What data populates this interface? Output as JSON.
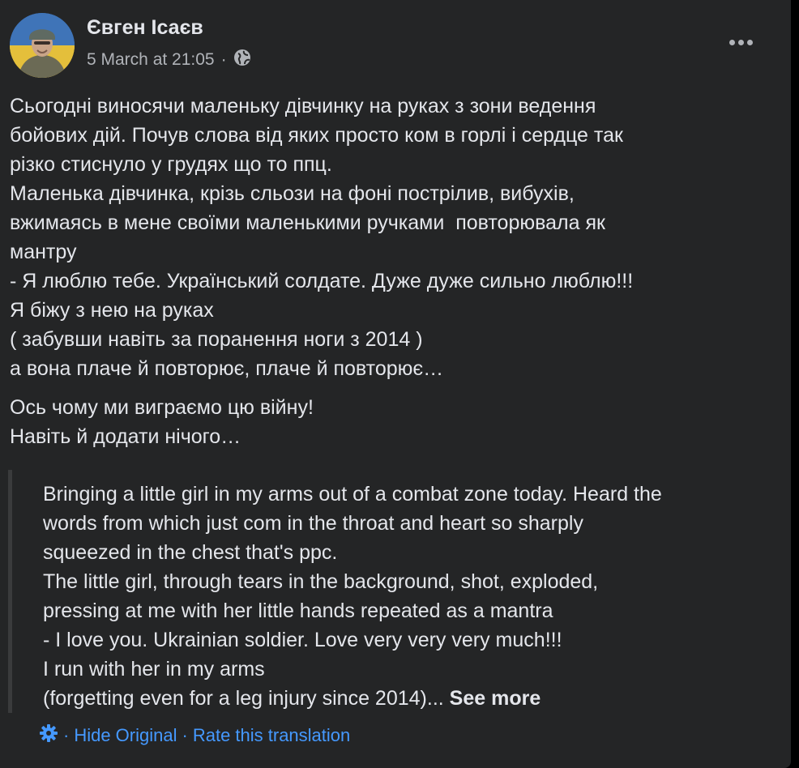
{
  "post": {
    "author": "Євген Ісаєв",
    "date": "5 March at 21:05",
    "separator": "·",
    "privacy_icon": "globe-icon",
    "more_icon": "more-horizontal-icon",
    "paragraph1": [
      "Сьогодні виносячи маленьку дівчинку на руках з зони ведення",
      "бойових дій. Почув слова від яких просто ком в горлі і сердце так",
      "різко стиснуло у грудях що то ппц.",
      "Маленька дівчинка, крізь сльози на фоні пострілив, вибухів,",
      "вжимаясь в мене своїми маленькими ручками  повторювала як",
      "мантру",
      "- Я люблю тебе. Український солдате. Дуже дуже сильно люблю!!!",
      "Я біжу з нею на руках",
      "( забувши навіть за поранення ноги з 2014 )",
      "а вона плаче й повторює, плаче й повторює…"
    ],
    "paragraph2": [
      "Ось чому ми виграємо цю війну!",
      "Навіть й додати нічого…"
    ]
  },
  "translation": {
    "lines": [
      "Bringing a little girl in my arms out of a combat zone today. Heard the",
      "words from which just com in the throat and heart so sharply",
      "squeezed in the chest that's ppc.",
      "The little girl, through tears in the background, shot, exploded,",
      "pressing at me with her little hands repeated as a mantra",
      "- I love you. Ukrainian soldier. Love very very very much!!!",
      "I run with her in my arms"
    ],
    "last_line": "(forgetting even for a leg injury since 2014)... ",
    "see_more": "See more",
    "settings_icon": "gear-icon",
    "separator": "·",
    "hide_original": "Hide Original",
    "rate_translation": "Rate this translation"
  },
  "colors": {
    "card_bg": "#242526",
    "text_primary": "#e4e6eb",
    "text_secondary": "#b0b3b8",
    "link_blue": "#4599ff"
  }
}
